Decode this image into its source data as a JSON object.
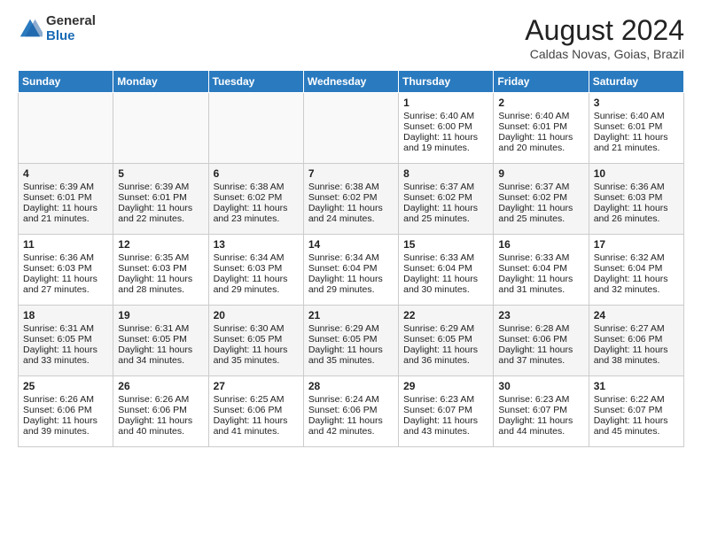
{
  "header": {
    "logo_general": "General",
    "logo_blue": "Blue",
    "month_title": "August 2024",
    "location": "Caldas Novas, Goias, Brazil"
  },
  "days_of_week": [
    "Sunday",
    "Monday",
    "Tuesday",
    "Wednesday",
    "Thursday",
    "Friday",
    "Saturday"
  ],
  "weeks": [
    [
      {
        "day": "",
        "sunrise": "",
        "sunset": "",
        "daylight": "",
        "empty": true
      },
      {
        "day": "",
        "sunrise": "",
        "sunset": "",
        "daylight": "",
        "empty": true
      },
      {
        "day": "",
        "sunrise": "",
        "sunset": "",
        "daylight": "",
        "empty": true
      },
      {
        "day": "",
        "sunrise": "",
        "sunset": "",
        "daylight": "",
        "empty": true
      },
      {
        "day": "1",
        "sunrise": "6:40 AM",
        "sunset": "6:00 PM",
        "daylight": "11 hours and 19 minutes.",
        "empty": false
      },
      {
        "day": "2",
        "sunrise": "6:40 AM",
        "sunset": "6:01 PM",
        "daylight": "11 hours and 20 minutes.",
        "empty": false
      },
      {
        "day": "3",
        "sunrise": "6:40 AM",
        "sunset": "6:01 PM",
        "daylight": "11 hours and 21 minutes.",
        "empty": false
      }
    ],
    [
      {
        "day": "4",
        "sunrise": "6:39 AM",
        "sunset": "6:01 PM",
        "daylight": "11 hours and 21 minutes.",
        "empty": false
      },
      {
        "day": "5",
        "sunrise": "6:39 AM",
        "sunset": "6:01 PM",
        "daylight": "11 hours and 22 minutes.",
        "empty": false
      },
      {
        "day": "6",
        "sunrise": "6:38 AM",
        "sunset": "6:02 PM",
        "daylight": "11 hours and 23 minutes.",
        "empty": false
      },
      {
        "day": "7",
        "sunrise": "6:38 AM",
        "sunset": "6:02 PM",
        "daylight": "11 hours and 24 minutes.",
        "empty": false
      },
      {
        "day": "8",
        "sunrise": "6:37 AM",
        "sunset": "6:02 PM",
        "daylight": "11 hours and 25 minutes.",
        "empty": false
      },
      {
        "day": "9",
        "sunrise": "6:37 AM",
        "sunset": "6:02 PM",
        "daylight": "11 hours and 25 minutes.",
        "empty": false
      },
      {
        "day": "10",
        "sunrise": "6:36 AM",
        "sunset": "6:03 PM",
        "daylight": "11 hours and 26 minutes.",
        "empty": false
      }
    ],
    [
      {
        "day": "11",
        "sunrise": "6:36 AM",
        "sunset": "6:03 PM",
        "daylight": "11 hours and 27 minutes.",
        "empty": false
      },
      {
        "day": "12",
        "sunrise": "6:35 AM",
        "sunset": "6:03 PM",
        "daylight": "11 hours and 28 minutes.",
        "empty": false
      },
      {
        "day": "13",
        "sunrise": "6:34 AM",
        "sunset": "6:03 PM",
        "daylight": "11 hours and 29 minutes.",
        "empty": false
      },
      {
        "day": "14",
        "sunrise": "6:34 AM",
        "sunset": "6:04 PM",
        "daylight": "11 hours and 29 minutes.",
        "empty": false
      },
      {
        "day": "15",
        "sunrise": "6:33 AM",
        "sunset": "6:04 PM",
        "daylight": "11 hours and 30 minutes.",
        "empty": false
      },
      {
        "day": "16",
        "sunrise": "6:33 AM",
        "sunset": "6:04 PM",
        "daylight": "11 hours and 31 minutes.",
        "empty": false
      },
      {
        "day": "17",
        "sunrise": "6:32 AM",
        "sunset": "6:04 PM",
        "daylight": "11 hours and 32 minutes.",
        "empty": false
      }
    ],
    [
      {
        "day": "18",
        "sunrise": "6:31 AM",
        "sunset": "6:05 PM",
        "daylight": "11 hours and 33 minutes.",
        "empty": false
      },
      {
        "day": "19",
        "sunrise": "6:31 AM",
        "sunset": "6:05 PM",
        "daylight": "11 hours and 34 minutes.",
        "empty": false
      },
      {
        "day": "20",
        "sunrise": "6:30 AM",
        "sunset": "6:05 PM",
        "daylight": "11 hours and 35 minutes.",
        "empty": false
      },
      {
        "day": "21",
        "sunrise": "6:29 AM",
        "sunset": "6:05 PM",
        "daylight": "11 hours and 35 minutes.",
        "empty": false
      },
      {
        "day": "22",
        "sunrise": "6:29 AM",
        "sunset": "6:05 PM",
        "daylight": "11 hours and 36 minutes.",
        "empty": false
      },
      {
        "day": "23",
        "sunrise": "6:28 AM",
        "sunset": "6:06 PM",
        "daylight": "11 hours and 37 minutes.",
        "empty": false
      },
      {
        "day": "24",
        "sunrise": "6:27 AM",
        "sunset": "6:06 PM",
        "daylight": "11 hours and 38 minutes.",
        "empty": false
      }
    ],
    [
      {
        "day": "25",
        "sunrise": "6:26 AM",
        "sunset": "6:06 PM",
        "daylight": "11 hours and 39 minutes.",
        "empty": false
      },
      {
        "day": "26",
        "sunrise": "6:26 AM",
        "sunset": "6:06 PM",
        "daylight": "11 hours and 40 minutes.",
        "empty": false
      },
      {
        "day": "27",
        "sunrise": "6:25 AM",
        "sunset": "6:06 PM",
        "daylight": "11 hours and 41 minutes.",
        "empty": false
      },
      {
        "day": "28",
        "sunrise": "6:24 AM",
        "sunset": "6:06 PM",
        "daylight": "11 hours and 42 minutes.",
        "empty": false
      },
      {
        "day": "29",
        "sunrise": "6:23 AM",
        "sunset": "6:07 PM",
        "daylight": "11 hours and 43 minutes.",
        "empty": false
      },
      {
        "day": "30",
        "sunrise": "6:23 AM",
        "sunset": "6:07 PM",
        "daylight": "11 hours and 44 minutes.",
        "empty": false
      },
      {
        "day": "31",
        "sunrise": "6:22 AM",
        "sunset": "6:07 PM",
        "daylight": "11 hours and 45 minutes.",
        "empty": false
      }
    ]
  ],
  "cell_labels": {
    "sunrise_prefix": "Sunrise: ",
    "sunset_prefix": "Sunset: ",
    "daylight_prefix": "Daylight: "
  }
}
